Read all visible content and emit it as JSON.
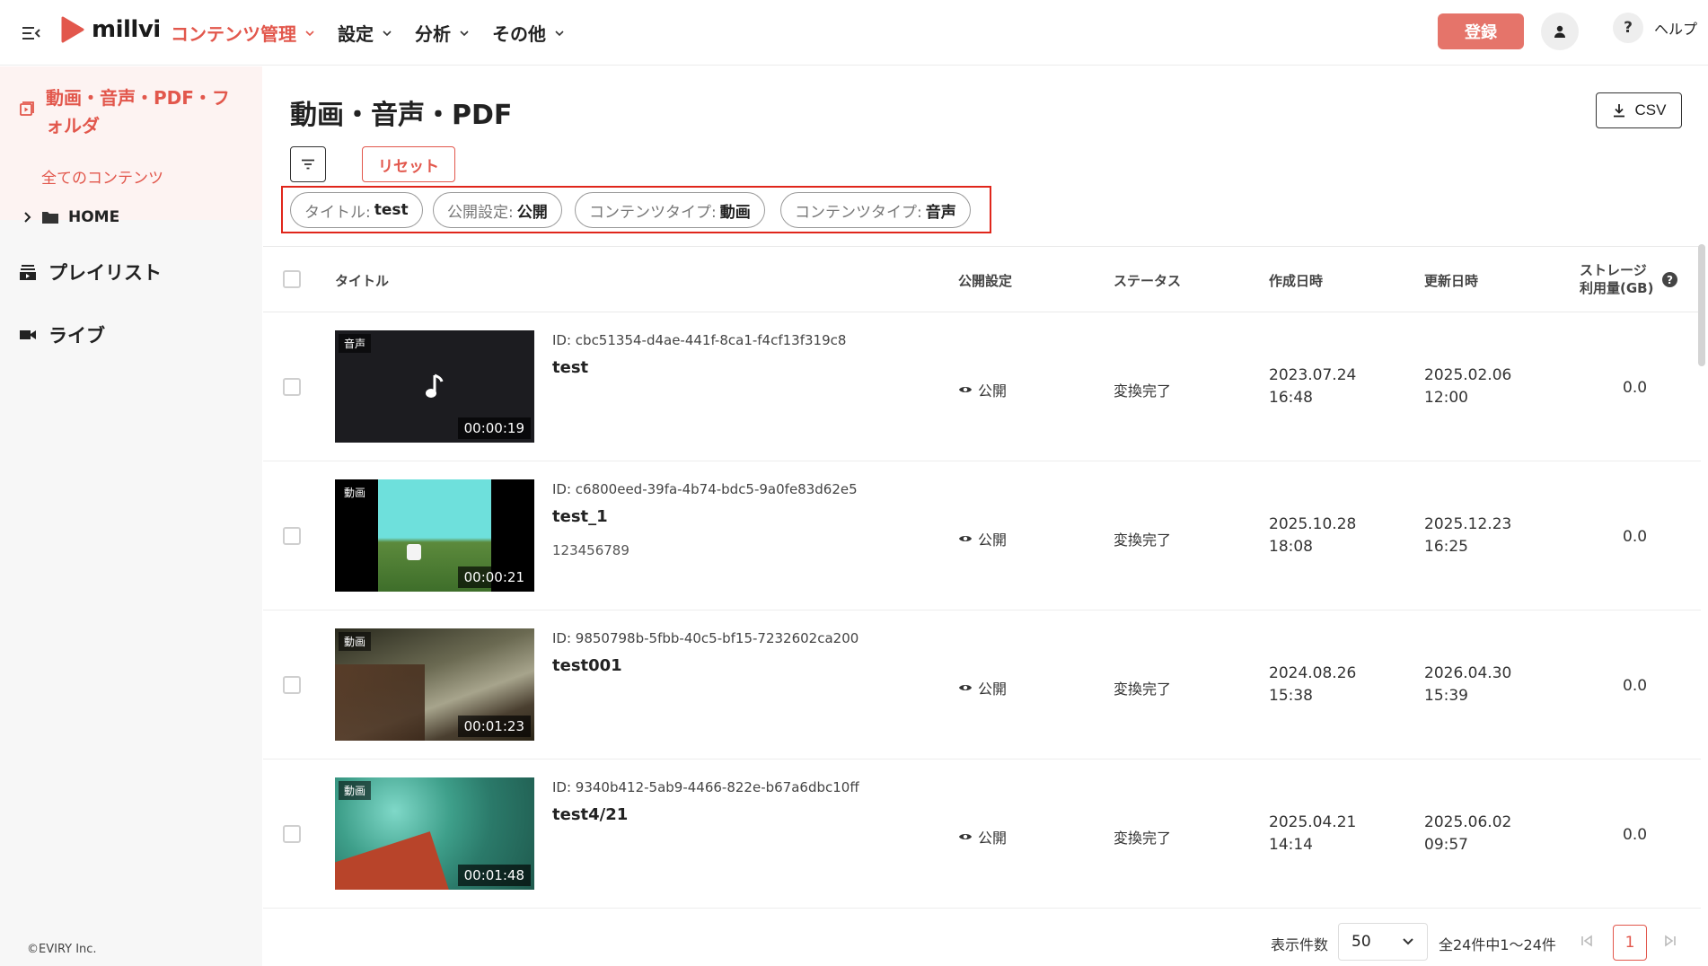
{
  "header": {
    "logo_text": "millvi",
    "nav": [
      {
        "label": "コンテンツ管理",
        "active": true
      },
      {
        "label": "設定",
        "active": false
      },
      {
        "label": "分析",
        "active": false
      },
      {
        "label": "その他",
        "active": false
      }
    ],
    "register_label": "登録",
    "help_label": "ヘルプ",
    "help_symbol": "?"
  },
  "sidebar": {
    "active_title": "動画・音声・PDF・フォルダ",
    "all_contents": "全てのコンテンツ",
    "home": "HOME",
    "playlist": "プレイリスト",
    "live": "ライブ",
    "copyright": "©EVIRY Inc."
  },
  "main": {
    "title": "動画・音声・PDF",
    "csv_label": "CSV",
    "reset_label": "リセット",
    "filters": [
      {
        "key": "タイトル:",
        "value": "test"
      },
      {
        "key": "公開設定:",
        "value": "公開"
      },
      {
        "key": "コンテンツタイプ:",
        "value": "動画"
      },
      {
        "key": "コンテンツタイプ:",
        "value": "音声"
      }
    ]
  },
  "table": {
    "headers": {
      "title": "タイトル",
      "publish": "公開設定",
      "status": "ステータス",
      "created": "作成日時",
      "updated": "更新日時",
      "storage_line1": "ストレージ",
      "storage_line2": "利用量(GB)"
    },
    "rows": [
      {
        "type": "音声",
        "duration": "00:00:19",
        "id": "ID: cbc51354-d4ae-441f-8ca1-f4cf13f319c8",
        "title": "test",
        "description": "",
        "publish": "公開",
        "status": "変換完了",
        "created_date": "2023.07.24",
        "created_time": "16:48",
        "updated_date": "2025.02.06",
        "updated_time": "12:00",
        "storage": "0.0"
      },
      {
        "type": "動画",
        "duration": "00:00:21",
        "id": "ID: c6800eed-39fa-4b74-bdc5-9a0fe83d62e5",
        "title": "test_1",
        "description": "123456789",
        "publish": "公開",
        "status": "変換完了",
        "created_date": "2025.10.28",
        "created_time": "18:08",
        "updated_date": "2025.12.23",
        "updated_time": "16:25",
        "storage": "0.0"
      },
      {
        "type": "動画",
        "duration": "00:01:23",
        "id": "ID: 9850798b-5fbb-40c5-bf15-7232602ca200",
        "title": "test001",
        "description": "",
        "publish": "公開",
        "status": "変換完了",
        "created_date": "2024.08.26",
        "created_time": "15:38",
        "updated_date": "2026.04.30",
        "updated_time": "15:39",
        "storage": "0.0"
      },
      {
        "type": "動画",
        "duration": "00:01:48",
        "id": "ID: 9340b412-5ab9-4466-822e-b67a6dbc10ff",
        "title": "test4/21",
        "description": "",
        "publish": "公開",
        "status": "変換完了",
        "created_date": "2025.04.21",
        "created_time": "14:14",
        "updated_date": "2025.06.02",
        "updated_time": "09:57",
        "storage": "0.0"
      }
    ]
  },
  "pagination": {
    "per_page_label": "表示件数",
    "per_page_value": "50",
    "range_text": "全24件中1〜24件",
    "current_page": "1"
  },
  "colors": {
    "accent": "#e2574c",
    "register_bg": "#e5746a",
    "highlight_box": "#e0261b"
  }
}
